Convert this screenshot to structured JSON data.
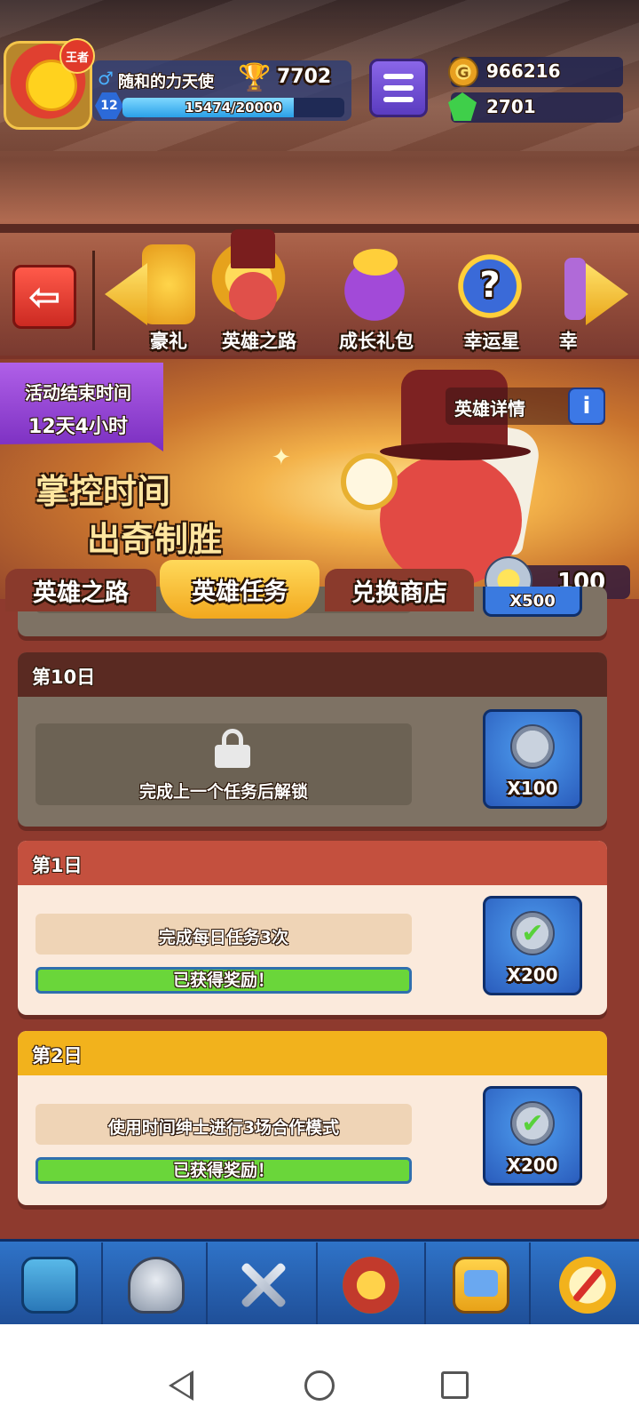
{
  "player": {
    "rank_badge": "王者",
    "gender_symbol": "♂",
    "name": "随和的力天使",
    "trophies": "7702",
    "level": "12",
    "xp_text": "15474/20000",
    "xp_fraction": 0.7737
  },
  "currency": {
    "gold_symbol": "G",
    "gold": "966216",
    "gems": "2701"
  },
  "events": {
    "items": [
      {
        "label": "豪礼",
        "icon": "gift-icon"
      },
      {
        "label": "英雄之路",
        "icon": "hero-gentleman-icon"
      },
      {
        "label": "成长礼包",
        "icon": "growth-pack-icon"
      },
      {
        "label": "幸运星",
        "icon": "lucky-star-icon"
      },
      {
        "label": "幸",
        "icon": "next-event-icon"
      }
    ],
    "back_symbol": "⇦",
    "luck_symbol": "?"
  },
  "banner": {
    "timer_label": "活动结束时间",
    "timer_value": "12天4小时",
    "slogan_line1": "掌控时间",
    "slogan_line2": "出奇制胜",
    "hero_detail": "英雄详情",
    "info_symbol": "i",
    "token_count": "100",
    "sparkle": "✦"
  },
  "tabs": [
    {
      "label": "英雄之路",
      "active": false
    },
    {
      "label": "英雄任务",
      "active": true
    },
    {
      "label": "兑换商店",
      "active": false
    }
  ],
  "missions": {
    "partial": {
      "reward": "X500"
    },
    "day10": {
      "day": "第10日",
      "task": "完成上一个任务后解锁",
      "reward": "X100",
      "locked": true
    },
    "day1": {
      "day": "第1日",
      "task": "完成每日任务3次",
      "status": "已获得奖励！",
      "reward": "X200",
      "completed": true
    },
    "day2": {
      "day": "第2日",
      "task": "使用时间绅士进行3场合作模式",
      "status": "已获得奖励！",
      "reward": "X200",
      "completed": true
    },
    "check_symbol": "✔"
  },
  "bottom_nav": [
    "chest-icon",
    "helmet-icon",
    "crossed-swords-icon",
    "crown-laurel-icon",
    "team-banner-icon",
    "compass-icon"
  ],
  "colors": {
    "accent_gold": "#f2a81e",
    "day1_header": "#c4503e",
    "day2_header": "#f2b21c",
    "progress_green": "#6ad63a",
    "nav_blue": "#2f73c8"
  }
}
